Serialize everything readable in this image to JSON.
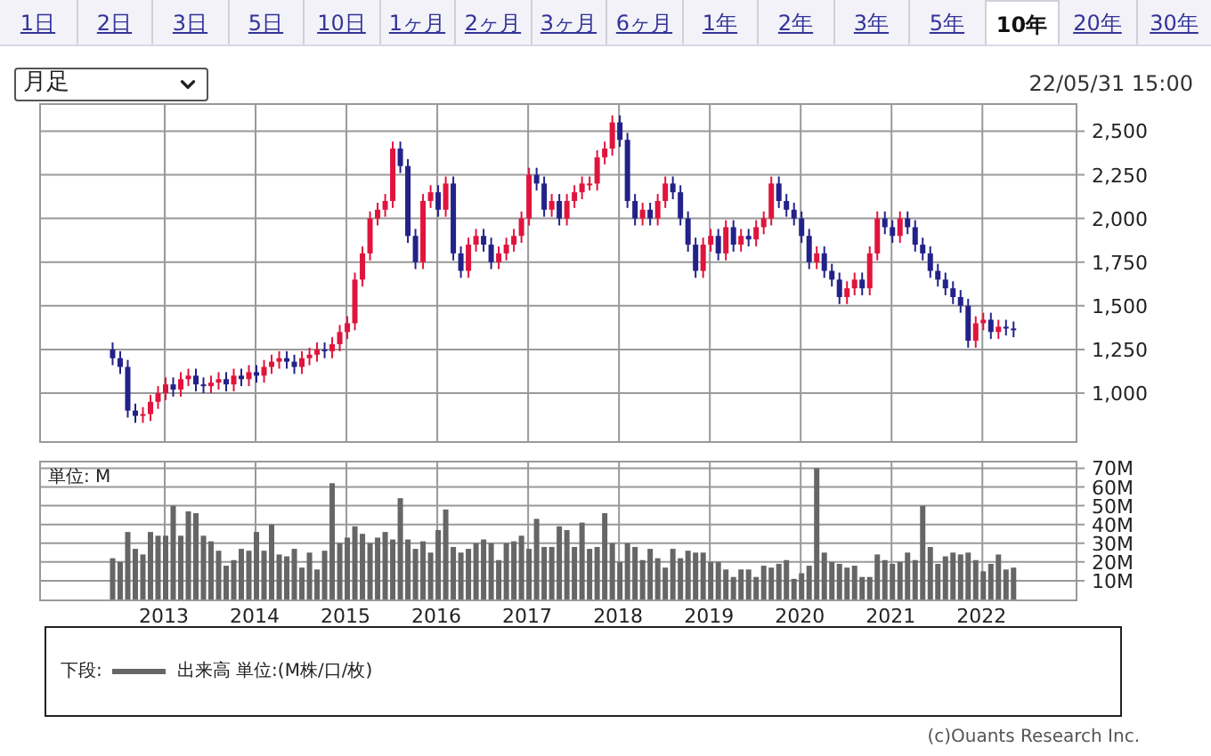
{
  "tabs": [
    {
      "label": "1日",
      "selected": false
    },
    {
      "label": "2日",
      "selected": false
    },
    {
      "label": "3日",
      "selected": false
    },
    {
      "label": "5日",
      "selected": false
    },
    {
      "label": "10日",
      "selected": false
    },
    {
      "label": "1ヶ月",
      "selected": false
    },
    {
      "label": "2ヶ月",
      "selected": false
    },
    {
      "label": "3ヶ月",
      "selected": false
    },
    {
      "label": "6ヶ月",
      "selected": false
    },
    {
      "label": "1年",
      "selected": false
    },
    {
      "label": "2年",
      "selected": false
    },
    {
      "label": "3年",
      "selected": false
    },
    {
      "label": "5年",
      "selected": false
    },
    {
      "label": "10年",
      "selected": true
    },
    {
      "label": "20年",
      "selected": false
    },
    {
      "label": "30年",
      "selected": false
    }
  ],
  "period_select": {
    "value": "月足"
  },
  "timestamp": "22/05/31 15:00",
  "price_chart": {
    "chart_data": {
      "type": "candlestick",
      "grid": true,
      "ylim": [
        725,
        2660
      ],
      "yticks": [
        {
          "value": 1000,
          "label": "1,000"
        },
        {
          "value": 1250,
          "label": "1,250"
        },
        {
          "value": 1500,
          "label": "1,500"
        },
        {
          "value": 1750,
          "label": "1,750"
        },
        {
          "value": 2000,
          "label": "2,000"
        },
        {
          "value": 2250,
          "label": "2,250"
        },
        {
          "value": 2500,
          "label": "2,500"
        }
      ],
      "categories": [
        null,
        null,
        null,
        null,
        null,
        null,
        null,
        null,
        null,
        null,
        null,
        null,
        null,
        null,
        null,
        null,
        null,
        null,
        null,
        null,
        null,
        null,
        null,
        null,
        null,
        null,
        null,
        null,
        null,
        null,
        null,
        null,
        null,
        null,
        null,
        null,
        null,
        null,
        null,
        null,
        null,
        null,
        null,
        null,
        null,
        null,
        null,
        null,
        null,
        null,
        null,
        null,
        null,
        null,
        null,
        null,
        null,
        null,
        null,
        null,
        null,
        null,
        null,
        null,
        null,
        null,
        null,
        null,
        null,
        null,
        null,
        null,
        null,
        null,
        null,
        null,
        null,
        null,
        null,
        null,
        null,
        null,
        null,
        null,
        null,
        null,
        null,
        null,
        null,
        null,
        null,
        null,
        null,
        null,
        null,
        null,
        null,
        null,
        null,
        null,
        null,
        null,
        null,
        null,
        null,
        null,
        null,
        null,
        null,
        null,
        null,
        null,
        null,
        null,
        null,
        null,
        null,
        null,
        null,
        null
      ],
      "ohlc": [
        [
          1250,
          1290,
          1160,
          1200
        ],
        [
          1200,
          1240,
          1110,
          1150
        ],
        [
          1150,
          1190,
          860,
          900
        ],
        [
          900,
          940,
          830,
          870
        ],
        [
          870,
          920,
          830,
          880
        ],
        [
          880,
          990,
          840,
          950
        ],
        [
          950,
          1040,
          910,
          1000
        ],
        [
          1000,
          1090,
          960,
          1050
        ],
        [
          1050,
          1090,
          980,
          1020
        ],
        [
          1020,
          1120,
          980,
          1080
        ],
        [
          1080,
          1140,
          1040,
          1100
        ],
        [
          1100,
          1140,
          1010,
          1050
        ],
        [
          1050,
          1090,
          1000,
          1040
        ],
        [
          1040,
          1100,
          1000,
          1060
        ],
        [
          1060,
          1120,
          1020,
          1080
        ],
        [
          1080,
          1120,
          1010,
          1050
        ],
        [
          1050,
          1140,
          1010,
          1100
        ],
        [
          1100,
          1140,
          1040,
          1080
        ],
        [
          1080,
          1160,
          1040,
          1120
        ],
        [
          1120,
          1160,
          1060,
          1100
        ],
        [
          1100,
          1190,
          1060,
          1150
        ],
        [
          1150,
          1220,
          1110,
          1180
        ],
        [
          1180,
          1240,
          1140,
          1200
        ],
        [
          1200,
          1240,
          1140,
          1180
        ],
        [
          1180,
          1220,
          1110,
          1150
        ],
        [
          1150,
          1240,
          1110,
          1200
        ],
        [
          1200,
          1260,
          1160,
          1220
        ],
        [
          1220,
          1290,
          1180,
          1250
        ],
        [
          1250,
          1290,
          1200,
          1240
        ],
        [
          1240,
          1320,
          1200,
          1280
        ],
        [
          1280,
          1390,
          1240,
          1350
        ],
        [
          1350,
          1440,
          1310,
          1400
        ],
        [
          1400,
          1690,
          1360,
          1650
        ],
        [
          1650,
          1840,
          1610,
          1800
        ],
        [
          1800,
          2040,
          1760,
          2000
        ],
        [
          2000,
          2090,
          1960,
          2050
        ],
        [
          2050,
          2140,
          2010,
          2100
        ],
        [
          2100,
          2440,
          2060,
          2400
        ],
        [
          2400,
          2440,
          2260,
          2300
        ],
        [
          2300,
          2340,
          1860,
          1900
        ],
        [
          1900,
          1940,
          1710,
          1750
        ],
        [
          1750,
          2140,
          1710,
          2100
        ],
        [
          2100,
          2190,
          2060,
          2150
        ],
        [
          2150,
          2190,
          2010,
          2050
        ],
        [
          2050,
          2240,
          2010,
          2200
        ],
        [
          2200,
          2240,
          1760,
          1800
        ],
        [
          1800,
          1840,
          1660,
          1700
        ],
        [
          1700,
          1890,
          1660,
          1850
        ],
        [
          1850,
          1940,
          1810,
          1900
        ],
        [
          1900,
          1940,
          1810,
          1850
        ],
        [
          1850,
          1890,
          1710,
          1750
        ],
        [
          1750,
          1840,
          1710,
          1800
        ],
        [
          1800,
          1890,
          1760,
          1850
        ],
        [
          1850,
          1940,
          1810,
          1900
        ],
        [
          1900,
          2040,
          1860,
          2000
        ],
        [
          2000,
          2290,
          1960,
          2250
        ],
        [
          2250,
          2290,
          2160,
          2200
        ],
        [
          2200,
          2240,
          2010,
          2050
        ],
        [
          2050,
          2140,
          2010,
          2100
        ],
        [
          2100,
          2140,
          1960,
          2000
        ],
        [
          2000,
          2140,
          1960,
          2100
        ],
        [
          2100,
          2190,
          2060,
          2150
        ],
        [
          2150,
          2240,
          2110,
          2200
        ],
        [
          2200,
          2240,
          2160,
          2200
        ],
        [
          2200,
          2390,
          2160,
          2350
        ],
        [
          2350,
          2440,
          2310,
          2400
        ],
        [
          2400,
          2590,
          2360,
          2550
        ],
        [
          2550,
          2590,
          2410,
          2450
        ],
        [
          2450,
          2490,
          2060,
          2100
        ],
        [
          2100,
          2140,
          1960,
          2000
        ],
        [
          2000,
          2090,
          1960,
          2050
        ],
        [
          2050,
          2090,
          1960,
          2000
        ],
        [
          2000,
          2140,
          1960,
          2100
        ],
        [
          2100,
          2240,
          2060,
          2200
        ],
        [
          2200,
          2240,
          2110,
          2150
        ],
        [
          2150,
          2190,
          1960,
          2000
        ],
        [
          2000,
          2040,
          1810,
          1850
        ],
        [
          1850,
          1890,
          1660,
          1700
        ],
        [
          1700,
          1890,
          1660,
          1850
        ],
        [
          1850,
          1940,
          1810,
          1900
        ],
        [
          1900,
          1940,
          1760,
          1800
        ],
        [
          1800,
          1990,
          1760,
          1950
        ],
        [
          1950,
          1990,
          1810,
          1850
        ],
        [
          1850,
          1940,
          1810,
          1900
        ],
        [
          1900,
          1940,
          1840,
          1880
        ],
        [
          1880,
          1990,
          1840,
          1950
        ],
        [
          1950,
          2040,
          1910,
          2000
        ],
        [
          2000,
          2240,
          1960,
          2200
        ],
        [
          2200,
          2240,
          2060,
          2100
        ],
        [
          2100,
          2140,
          2010,
          2050
        ],
        [
          2050,
          2090,
          1960,
          2000
        ],
        [
          2000,
          2040,
          1860,
          1900
        ],
        [
          1900,
          1940,
          1710,
          1750
        ],
        [
          1750,
          1840,
          1710,
          1800
        ],
        [
          1800,
          1840,
          1660,
          1700
        ],
        [
          1700,
          1740,
          1610,
          1650
        ],
        [
          1650,
          1690,
          1510,
          1550
        ],
        [
          1550,
          1640,
          1510,
          1600
        ],
        [
          1600,
          1690,
          1560,
          1650
        ],
        [
          1650,
          1690,
          1560,
          1600
        ],
        [
          1600,
          1840,
          1560,
          1800
        ],
        [
          1800,
          2040,
          1760,
          2000
        ],
        [
          2000,
          2040,
          1910,
          1950
        ],
        [
          1950,
          1990,
          1860,
          1900
        ],
        [
          1900,
          2040,
          1860,
          2000
        ],
        [
          2000,
          2040,
          1910,
          1950
        ],
        [
          1950,
          1990,
          1810,
          1850
        ],
        [
          1850,
          1890,
          1760,
          1800
        ],
        [
          1800,
          1840,
          1660,
          1700
        ],
        [
          1700,
          1740,
          1610,
          1650
        ],
        [
          1650,
          1690,
          1560,
          1600
        ],
        [
          1600,
          1640,
          1510,
          1550
        ],
        [
          1550,
          1590,
          1460,
          1500
        ],
        [
          1500,
          1540,
          1260,
          1300
        ],
        [
          1300,
          1440,
          1260,
          1400
        ],
        [
          1400,
          1460,
          1360,
          1420
        ],
        [
          1420,
          1460,
          1310,
          1350
        ],
        [
          1350,
          1420,
          1310,
          1380
        ],
        [
          1380,
          1420,
          1330,
          1370
        ],
        [
          1370,
          1410,
          1320,
          1360
        ]
      ]
    }
  },
  "volume_chart": {
    "unit_label": "単位: M",
    "chart_data": {
      "type": "bar",
      "grid": true,
      "ylim": [
        0,
        74
      ],
      "yticks": [
        {
          "value": 10,
          "label": "10M"
        },
        {
          "value": 20,
          "label": "20M"
        },
        {
          "value": 30,
          "label": "30M"
        },
        {
          "value": 40,
          "label": "40M"
        },
        {
          "value": 50,
          "label": "50M"
        },
        {
          "value": 60,
          "label": "60M"
        },
        {
          "value": 70,
          "label": "70M"
        }
      ],
      "categories": [
        null,
        null,
        null,
        null,
        null,
        null,
        null,
        "2013",
        null,
        null,
        null,
        null,
        null,
        null,
        null,
        null,
        null,
        null,
        null,
        "2014",
        null,
        null,
        null,
        null,
        null,
        null,
        null,
        null,
        null,
        null,
        null,
        "2015",
        null,
        null,
        null,
        null,
        null,
        null,
        null,
        null,
        null,
        null,
        null,
        "2016",
        null,
        null,
        null,
        null,
        null,
        null,
        null,
        null,
        null,
        null,
        null,
        "2017",
        null,
        null,
        null,
        null,
        null,
        null,
        null,
        null,
        null,
        null,
        null,
        "2018",
        null,
        null,
        null,
        null,
        null,
        null,
        null,
        null,
        null,
        null,
        null,
        "2019",
        null,
        null,
        null,
        null,
        null,
        null,
        null,
        null,
        null,
        null,
        null,
        "2020",
        null,
        null,
        null,
        null,
        null,
        null,
        null,
        null,
        null,
        null,
        null,
        "2021",
        null,
        null,
        null,
        null,
        null,
        null,
        null,
        null,
        null,
        null,
        null,
        "2022",
        null,
        null,
        null,
        null
      ],
      "series": [
        {
          "name": "出来高",
          "color": "#666666",
          "values": [
            22,
            20,
            36,
            27,
            24,
            36,
            34,
            34,
            50,
            34,
            47,
            46,
            34,
            31,
            26,
            18,
            21,
            27,
            26,
            36,
            26,
            40,
            24,
            23,
            27,
            17,
            25,
            16,
            26,
            62,
            30,
            33,
            39,
            35,
            30,
            33,
            36,
            32,
            54,
            32,
            27,
            31,
            25,
            37,
            48,
            28,
            25,
            27,
            30,
            32,
            30,
            21,
            30,
            31,
            34,
            27,
            43,
            28,
            28,
            39,
            37,
            28,
            41,
            27,
            28,
            46,
            30,
            20,
            30,
            28,
            21,
            27,
            22,
            17,
            27,
            22,
            26,
            25,
            25,
            20,
            20,
            16,
            12,
            16,
            16,
            12,
            18,
            17,
            19,
            21,
            11,
            14,
            18,
            70,
            25,
            20,
            19,
            17,
            18,
            12,
            12,
            24,
            21,
            19,
            20,
            25,
            21,
            50,
            28,
            19,
            23,
            25,
            24,
            25,
            21,
            15,
            19,
            24,
            16,
            17
          ]
        }
      ]
    }
  },
  "legend": {
    "label": "下段:",
    "unit": "単位:(M株/口/枚)"
  },
  "copyright": "(c)Ouants Research Inc."
}
